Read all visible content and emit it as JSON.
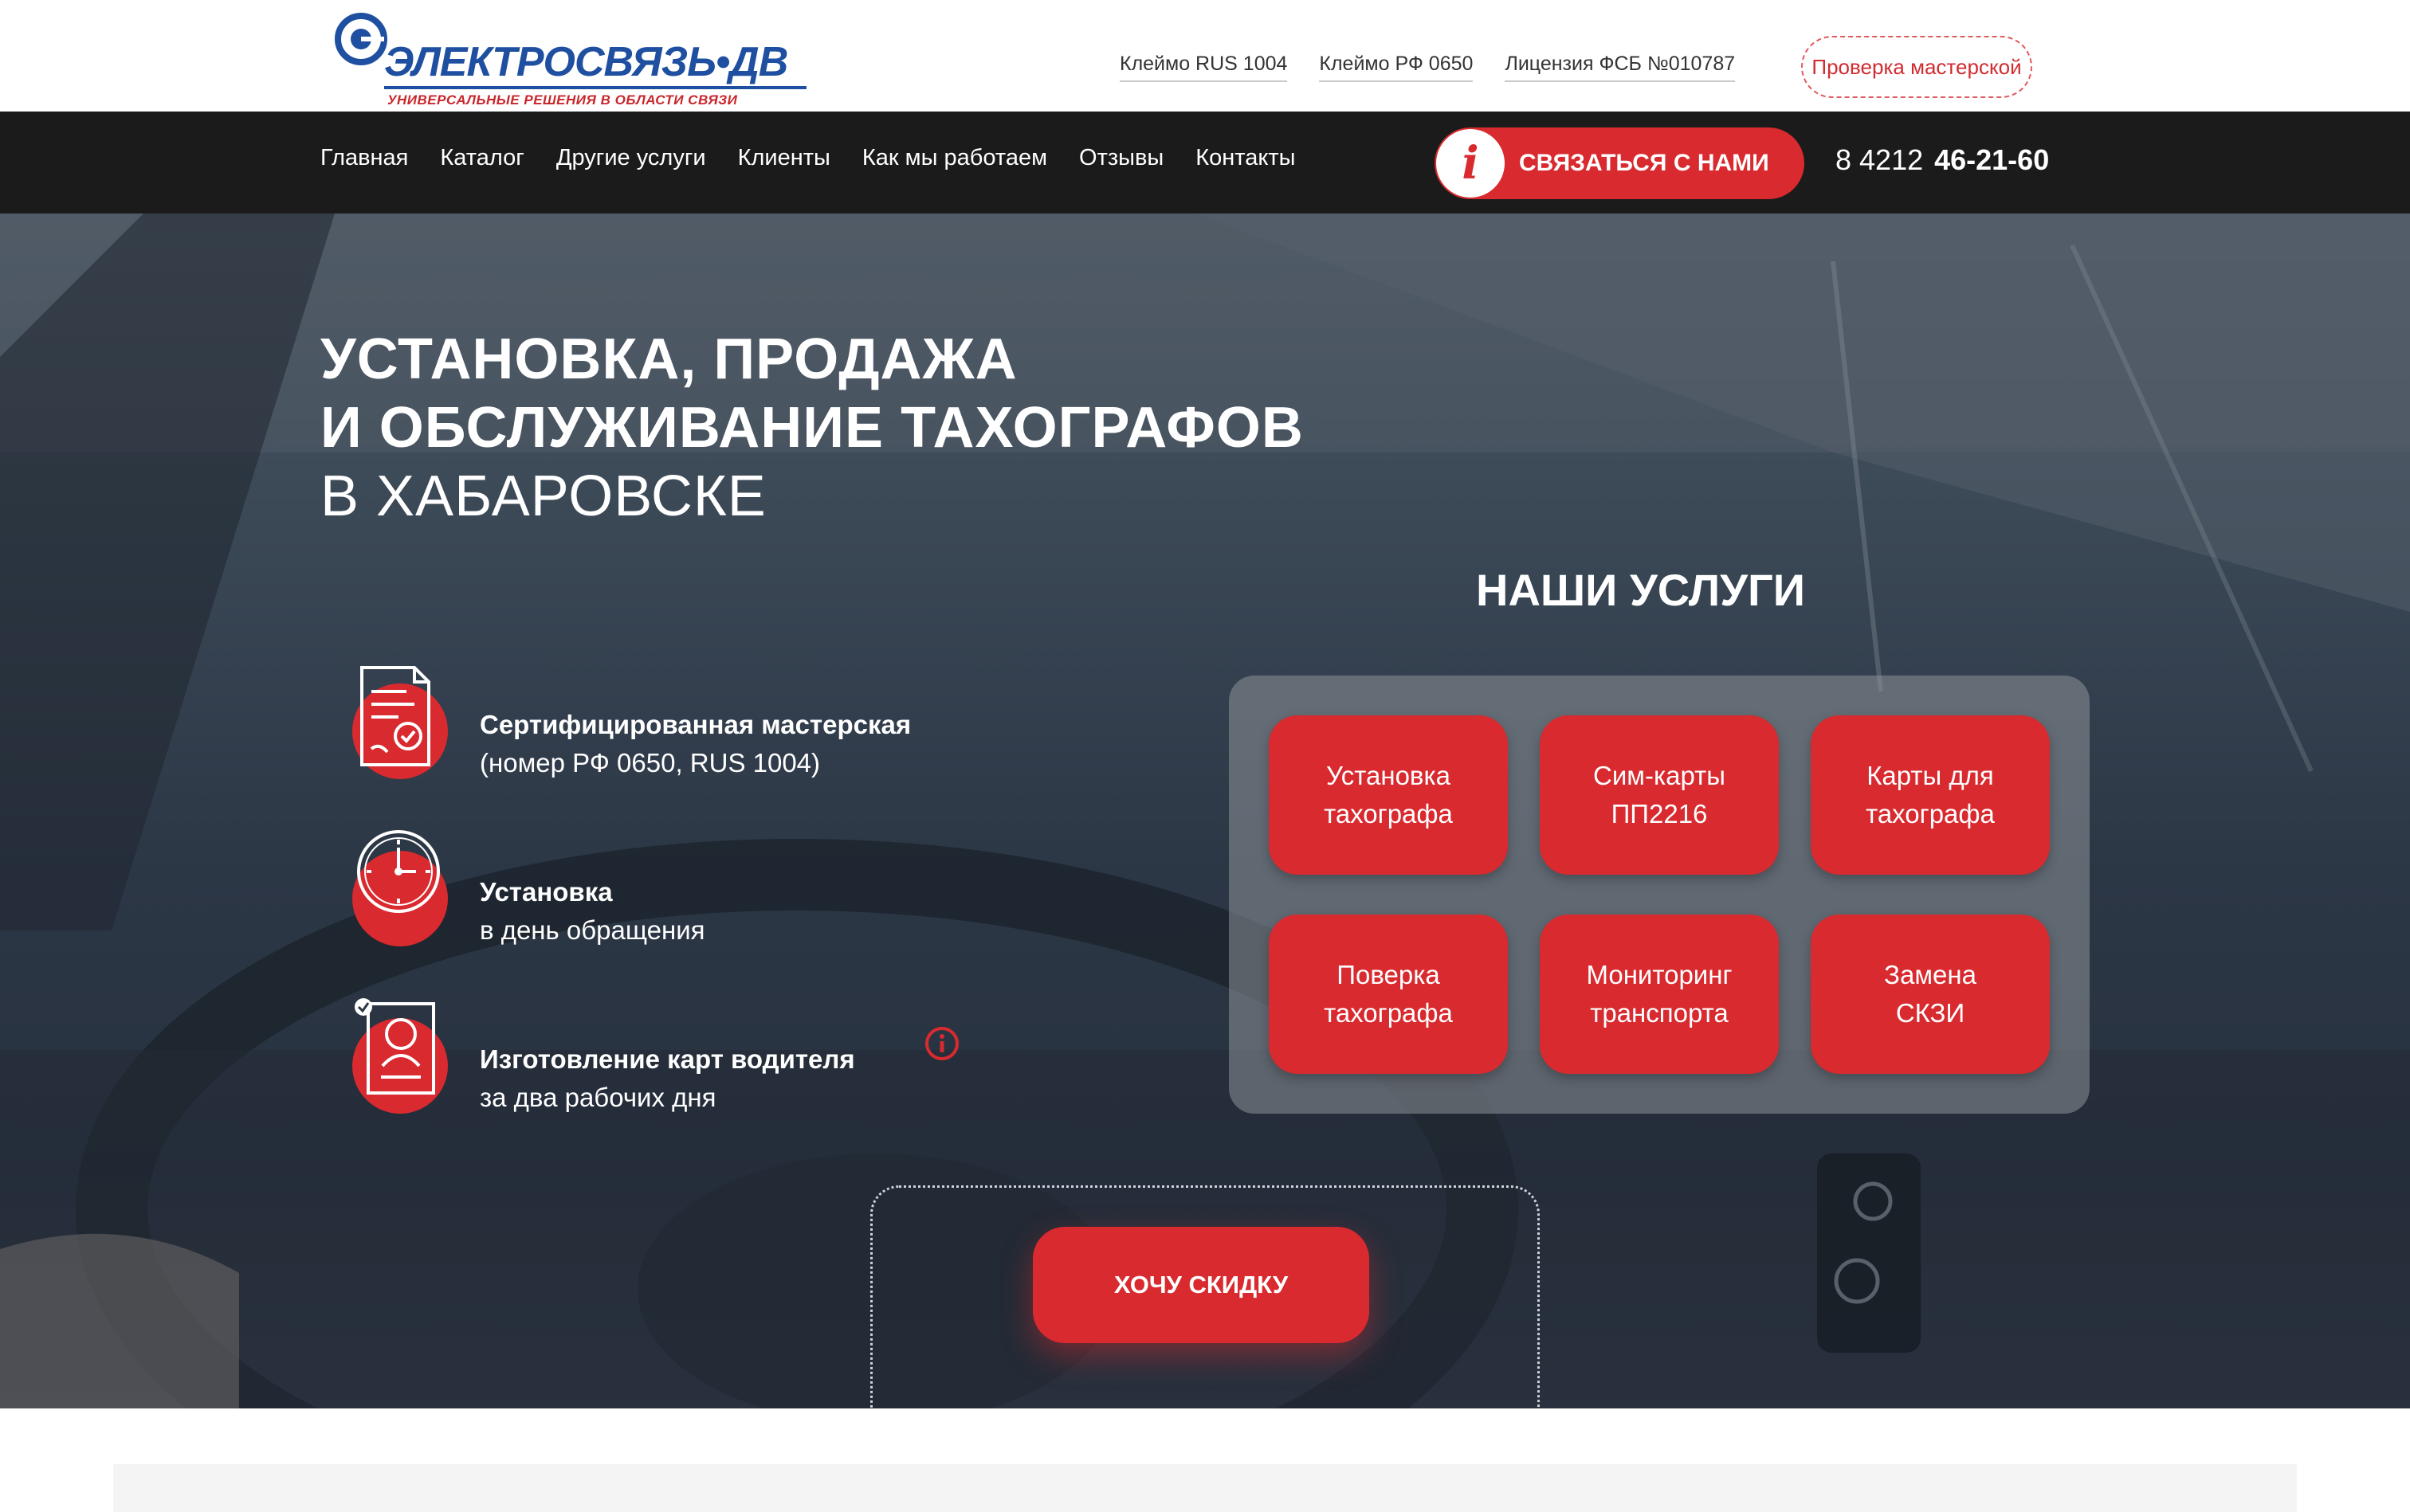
{
  "logo": {
    "title": "ЭЛЕКТРОСВЯЗЬ•ДВ",
    "subtitle": "УНИВЕРСАЛЬНЫЕ РЕШЕНИЯ В ОБЛАСТИ СВЯЗИ"
  },
  "header": {
    "links": [
      "Клеймо RUS 1004",
      "Клеймо РФ 0650",
      "Лицензия ФСБ №010787"
    ],
    "check_button": "Проверка мастерской"
  },
  "nav": {
    "items": [
      "Главная",
      "Каталог",
      "Другие услуги",
      "Клиенты",
      "Как мы работаем",
      "Отзывы",
      "Контакты"
    ],
    "contact_button": "СВЯЗАТЬСЯ С НАМИ",
    "contact_icon": "i",
    "phone_code": "8 4212",
    "phone_number": "46-21-60"
  },
  "hero": {
    "title_line1": "УСТАНОВКА, ПРОДАЖА",
    "title_line2": "И ОБСЛУЖИВАНИЕ ТАХОГРАФОВ",
    "title_line3": "В ХАБАРОВСКЕ"
  },
  "features": [
    {
      "icon": "certificate-icon",
      "title": "Сертифицированная мастерская",
      "subtitle": "(номер РФ 0650, RUS 1004)"
    },
    {
      "icon": "clock-icon",
      "title": "Установка",
      "subtitle": "в день обращения"
    },
    {
      "icon": "driver-card-icon",
      "title": "Изготовление карт водителя",
      "subtitle": "за два рабочих дня"
    }
  ],
  "services": {
    "title": "НАШИ УСЛУГИ",
    "items": [
      {
        "line1": "Установка",
        "line2": "тахографа"
      },
      {
        "line1": "Сим-карты",
        "line2": "ПП2216"
      },
      {
        "line1": "Карты для",
        "line2": "тахографа"
      },
      {
        "line1": "Поверка",
        "line2": "тахографа"
      },
      {
        "line1": "Мониторинг",
        "line2": "транспорта"
      },
      {
        "line1": "Замена",
        "line2": "СКЗИ"
      }
    ]
  },
  "cta": {
    "discount_button": "ХОЧУ СКИДКУ"
  },
  "colors": {
    "accent": "#d82a2f",
    "brand_blue": "#1f4fa0",
    "nav_bg": "#1b1b1b"
  }
}
